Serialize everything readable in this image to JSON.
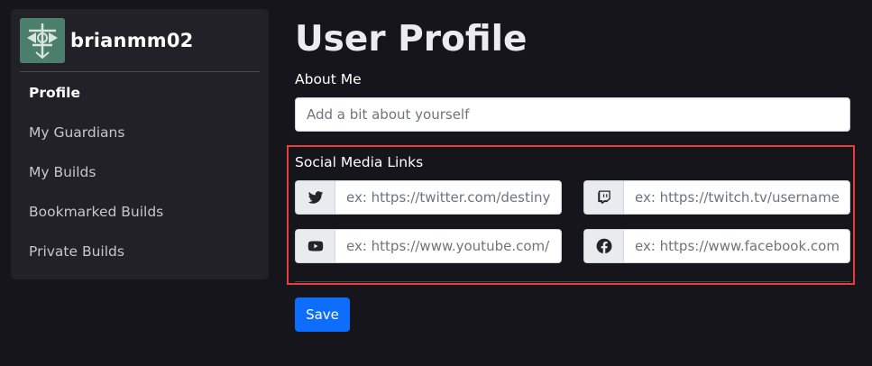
{
  "sidebar": {
    "username": "brianmm02",
    "items": [
      {
        "label": "Profile",
        "active": true
      },
      {
        "label": "My Guardians",
        "active": false
      },
      {
        "label": "My Builds",
        "active": false
      },
      {
        "label": "Bookmarked Builds",
        "active": false
      },
      {
        "label": "Private Builds",
        "active": false
      }
    ]
  },
  "main": {
    "title": "User Profile",
    "about_label": "About Me",
    "about_placeholder": "Add a bit about yourself",
    "about_value": "",
    "social_label": "Social Media Links",
    "social": {
      "twitter": {
        "icon": "twitter-icon",
        "placeholder": "ex: https://twitter.com/destinyt",
        "value": ""
      },
      "twitch": {
        "icon": "twitch-icon",
        "placeholder": "ex: https://twitch.tv/username",
        "value": ""
      },
      "youtube": {
        "icon": "youtube-icon",
        "placeholder": "ex: https://www.youtube.com/",
        "value": ""
      },
      "facebook": {
        "icon": "facebook-icon",
        "placeholder": "ex: https://www.facebook.com/",
        "value": ""
      }
    },
    "save_label": "Save"
  },
  "colors": {
    "background": "#15151b",
    "sidebar": "#212127",
    "accent": "#0d6efd",
    "highlight_border": "#e63c3c"
  }
}
